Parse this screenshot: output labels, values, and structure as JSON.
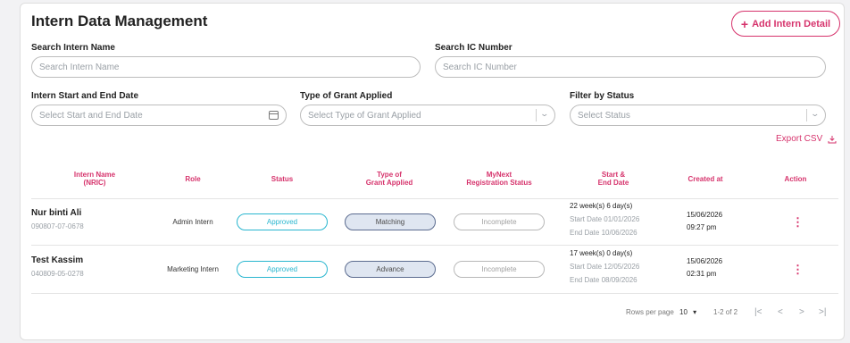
{
  "header": {
    "title": "Intern Data Management",
    "add_button_label": "Add Intern Detail",
    "add_icon": "plus-icon"
  },
  "filters": {
    "name_label": "Search Intern Name",
    "name_placeholder": "Search Intern Name",
    "ic_label": "Search IC Number",
    "ic_placeholder": "Search IC Number",
    "date_label": "Intern Start and End Date",
    "date_placeholder": "Select Start and End Date",
    "date_icon": "calendar-icon",
    "grant_label": "Type of Grant Applied",
    "grant_placeholder": "Select Type of Grant Applied",
    "status_label": "Filter by Status",
    "status_placeholder": "Select Status"
  },
  "export": {
    "label": "Export CSV",
    "icon": "download-icon"
  },
  "table": {
    "columns": {
      "name_l1": "Intern Name",
      "name_l2": "(NRIC)",
      "role": "Role",
      "status": "Status",
      "grant_l1": "Type of",
      "grant_l2": "Grant Applied",
      "reg_l1": "MyNext",
      "reg_l2": "Registration Status",
      "dates_l1": "Start &",
      "dates_l2": "End Date",
      "created": "Created at",
      "action": "Action"
    },
    "rows": [
      {
        "name": "Nur binti Ali",
        "nric": "090807-07-0678",
        "role": "Admin Intern",
        "status": "Approved",
        "grant": "Matching",
        "registration": "Incomplete",
        "duration": "22 week(s) 6 day(s)",
        "start": "Start Date 01/01/2026",
        "end": "End Date 10/06/2026",
        "created_date": "15/06/2026",
        "created_time": "09:27 pm"
      },
      {
        "name": "Test Kassim",
        "nric": "040809-05-0278",
        "role": "Marketing Intern",
        "status": "Approved",
        "grant": "Advance",
        "registration": "Incomplete",
        "duration": "17 week(s) 0 day(s)",
        "start": "Start Date 12/05/2026",
        "end": "End Date 08/09/2026",
        "created_date": "15/06/2026",
        "created_time": "02:31 pm"
      }
    ]
  },
  "pagination": {
    "rows_per_page_label": "Rows per page",
    "rows_per_page": "10",
    "range": "1-2 of 2"
  },
  "colors": {
    "accent": "#d6336c",
    "approved": "#29b6cf",
    "grant_fill": "#dfe6f1"
  }
}
